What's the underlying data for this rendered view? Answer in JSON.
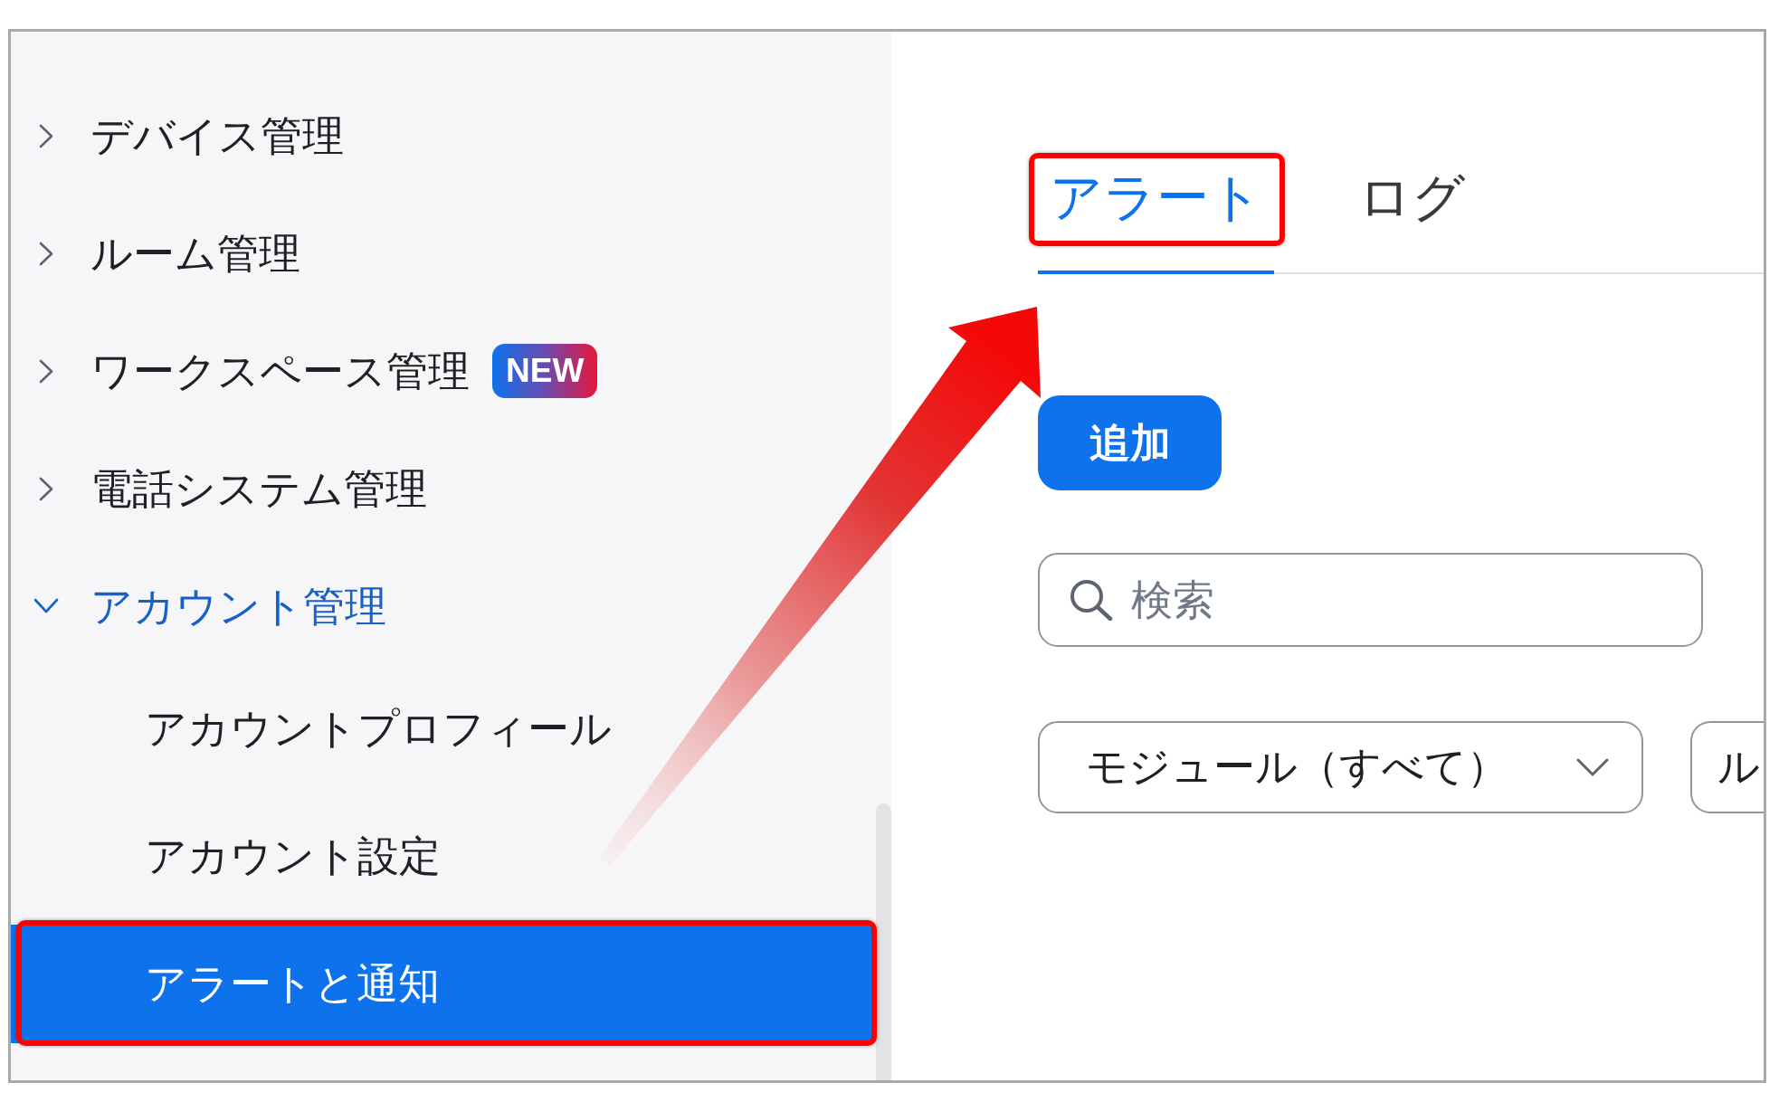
{
  "sidebar": {
    "items": [
      {
        "label": "デバイス管理",
        "expanded": false
      },
      {
        "label": "ルーム管理",
        "expanded": false
      },
      {
        "label": "ワークスペース管理",
        "expanded": false,
        "badge": "NEW"
      },
      {
        "label": "電話システム管理",
        "expanded": false
      },
      {
        "label": "アカウント管理",
        "expanded": true,
        "children": [
          {
            "label": "アカウントプロフィール",
            "selected": false,
            "highlighted": false
          },
          {
            "label": "アカウント設定",
            "selected": false,
            "highlighted": false
          },
          {
            "label": "アラートと通知",
            "selected": true,
            "highlighted": true
          }
        ]
      }
    ]
  },
  "tabs": [
    {
      "label": "アラート",
      "selected": true,
      "highlighted": true
    },
    {
      "label": "ログ",
      "selected": false,
      "highlighted": false
    }
  ],
  "add_button": "追加",
  "search": {
    "placeholder": "検索"
  },
  "filters": [
    {
      "kind": "dropdown",
      "label": "モジュール（すべて）"
    },
    {
      "kind": "partial",
      "label": "ル"
    }
  ],
  "callout_arrow": true
}
